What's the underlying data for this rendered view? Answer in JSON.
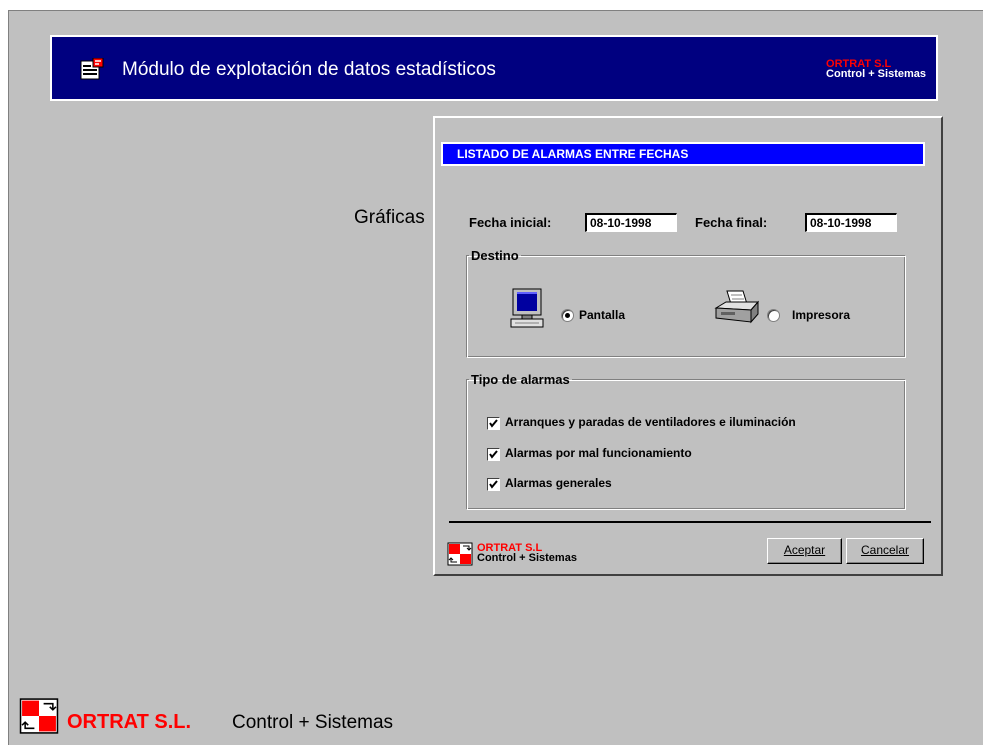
{
  "header": {
    "title": "Módulo de explotación de datos estadísticos",
    "brand_name": "ORTRAT S.L",
    "brand_tagline": "Control + Sistemas"
  },
  "menu": {
    "graficas": "Gráficas"
  },
  "dialog": {
    "title": "LISTADO DE ALARMAS ENTRE FECHAS",
    "fecha_inicial_label": "Fecha inicial:",
    "fecha_inicial_value": "08-10-1998",
    "fecha_final_label": "Fecha final:",
    "fecha_final_value": "08-10-1998",
    "destino": {
      "legend": "Destino",
      "options": [
        {
          "label": "Pantalla",
          "selected": true,
          "icon": "monitor-icon"
        },
        {
          "label": "Impresora",
          "selected": false,
          "icon": "printer-icon"
        }
      ]
    },
    "tipo": {
      "legend": "Tipo de alarmas",
      "options": [
        {
          "label": "Arranques y paradas de ventiladores e iluminación",
          "checked": true
        },
        {
          "label": "Alarmas por mal funcionamiento",
          "checked": true
        },
        {
          "label": "Alarmas generales",
          "checked": true
        }
      ]
    },
    "buttons": {
      "aceptar": "Aceptar",
      "cancelar": "Cancelar"
    },
    "brand_name": "ORTRAT S.L",
    "brand_tagline": "Control + Sistemas"
  },
  "footer": {
    "company": "ORTRAT S.L.",
    "tagline": "Control + Sistemas"
  },
  "colors": {
    "title_bar": "#000080",
    "dialog_title": "#0000ff",
    "brand_red": "#ff0000",
    "background": "#c0c0c0"
  }
}
